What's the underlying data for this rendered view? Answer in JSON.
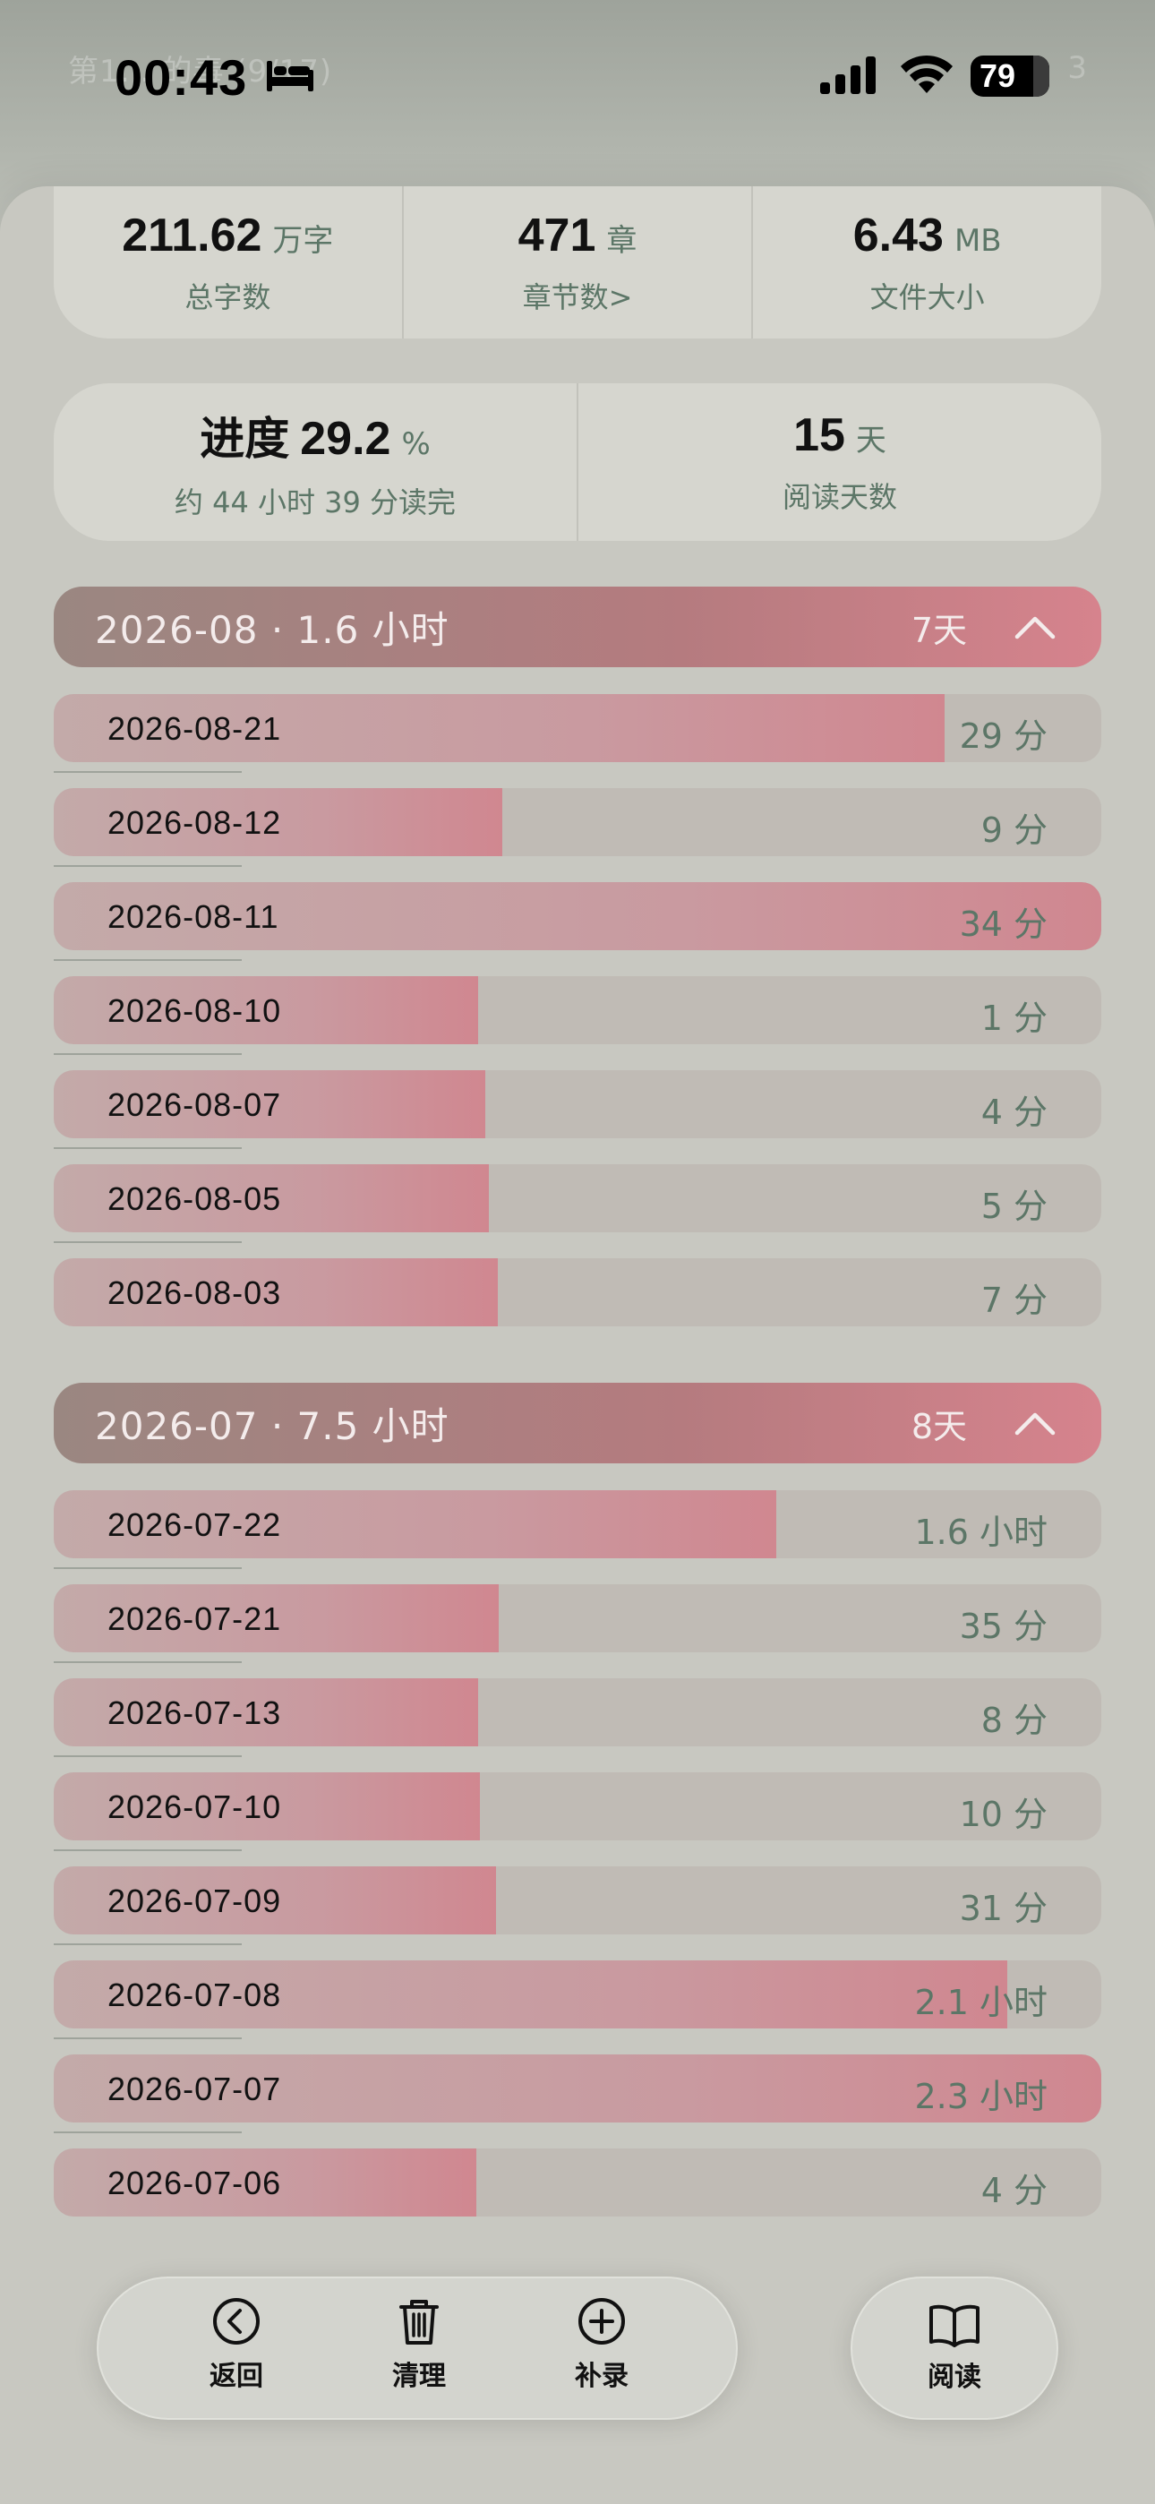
{
  "status_bar": {
    "time": "00:43",
    "battery": "79",
    "background_chapter": "第1…      的毒 (9/17)",
    "background_page": "3"
  },
  "stats": {
    "total_words": {
      "value": "211.62",
      "unit": "万字",
      "label": "总字数"
    },
    "chapters": {
      "value": "471",
      "unit": "章",
      "label": "章节数>"
    },
    "file_size": {
      "value": "6.43",
      "unit": "MB",
      "label": "文件大小"
    },
    "progress": {
      "prefix": "进度",
      "value": "29.2",
      "unit": "%",
      "label": "约 44 小时 39 分读完"
    },
    "reading_days": {
      "value": "15",
      "unit": "天",
      "label": "阅读天数"
    }
  },
  "months": [
    {
      "title": "2026-08 · 1.6 小时",
      "days_label": "7天",
      "rows": [
        {
          "date": "2026-08-21",
          "duration": "29 分",
          "fill": 0.85
        },
        {
          "date": "2026-08-12",
          "duration": "9 分",
          "fill": 0.428
        },
        {
          "date": "2026-08-11",
          "duration": "34 分",
          "fill": 1.0
        },
        {
          "date": "2026-08-10",
          "duration": "1 分",
          "fill": 0.405
        },
        {
          "date": "2026-08-07",
          "duration": "4 分",
          "fill": 0.412
        },
        {
          "date": "2026-08-05",
          "duration": "5 分",
          "fill": 0.415
        },
        {
          "date": "2026-08-03",
          "duration": "7 分",
          "fill": 0.424
        }
      ]
    },
    {
      "title": "2026-07 · 7.5 小时",
      "days_label": "8天",
      "rows": [
        {
          "date": "2026-07-22",
          "duration": "1.6 小时",
          "fill": 0.69
        },
        {
          "date": "2026-07-21",
          "duration": "35 分",
          "fill": 0.425
        },
        {
          "date": "2026-07-13",
          "duration": "8 分",
          "fill": 0.405
        },
        {
          "date": "2026-07-10",
          "duration": "10 分",
          "fill": 0.407
        },
        {
          "date": "2026-07-09",
          "duration": "31 分",
          "fill": 0.422
        },
        {
          "date": "2026-07-08",
          "duration": "2.1 小时",
          "fill": 0.91
        },
        {
          "date": "2026-07-07",
          "duration": "2.3 小时",
          "fill": 1.0
        },
        {
          "date": "2026-07-06",
          "duration": "4 分",
          "fill": 0.403
        }
      ]
    }
  ],
  "toolbar": {
    "back_label": "返回",
    "clear_label": "清理",
    "add_label": "补录",
    "read_label": "阅读"
  },
  "colors": {
    "accent": "#d08790",
    "muted_text": "#5c7667",
    "card": "#d6d6cf"
  }
}
